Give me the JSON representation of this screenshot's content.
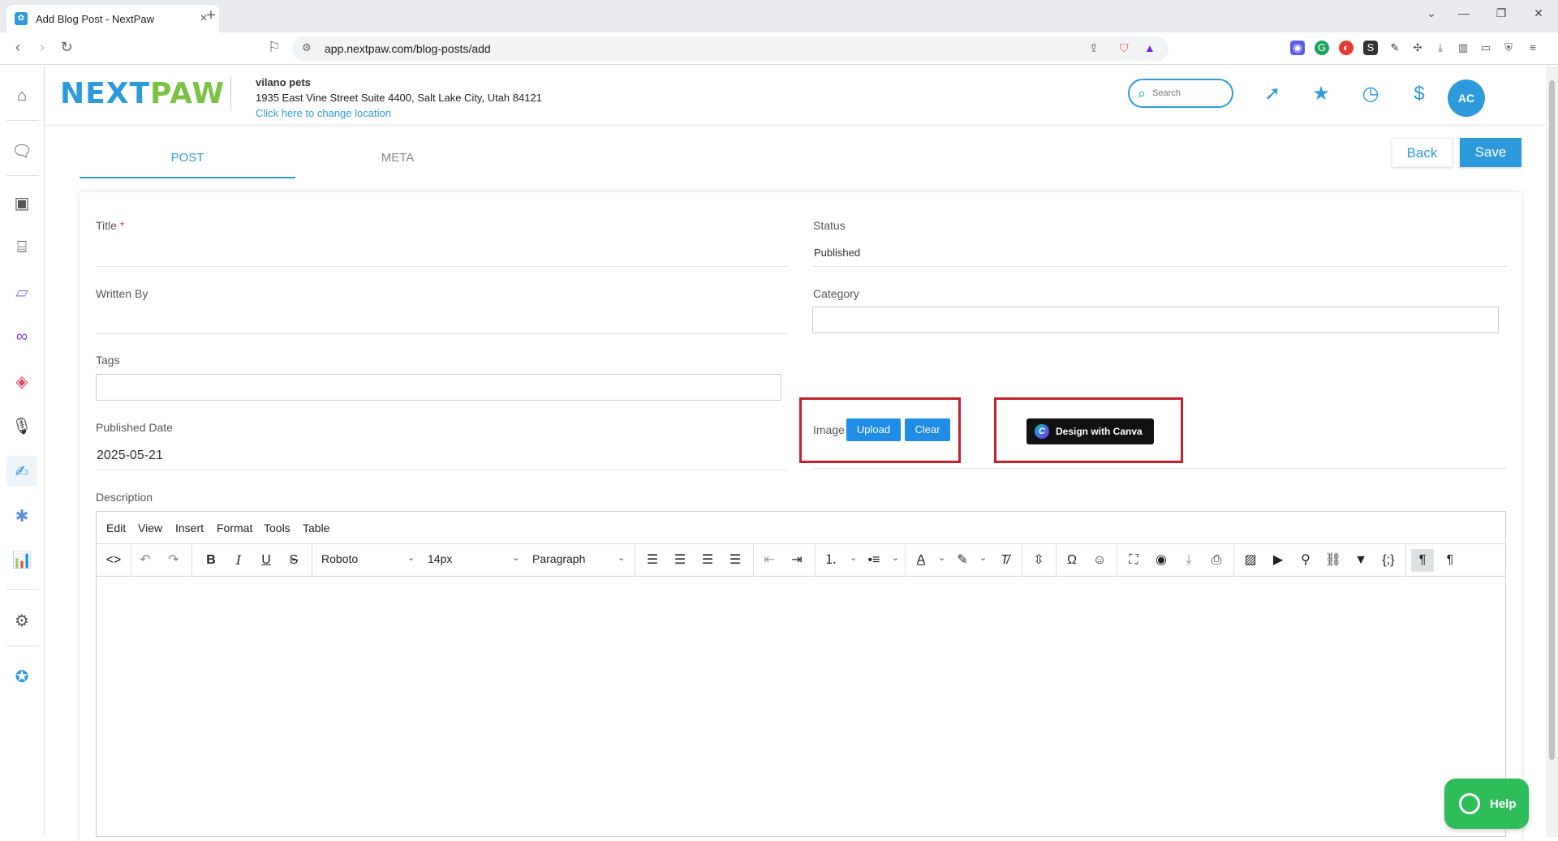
{
  "browser": {
    "tab_title": "Add Blog Post - NextPaw",
    "url": "app.nextpaw.com/blog-posts/add"
  },
  "header": {
    "logo_next": "NEXT",
    "logo_paw": "PAW",
    "location_name": "vilano pets",
    "location_address": "1935 East Vine Street Suite 4400, Salt Lake City, Utah 84121",
    "change_location": "Click here to change location",
    "search_placeholder": "Search",
    "avatar_initials": "AC"
  },
  "tabs": [
    {
      "label": "POST",
      "active": true
    },
    {
      "label": "META",
      "active": false
    }
  ],
  "actions": {
    "back": "Back",
    "save": "Save"
  },
  "form": {
    "title_label": "Title",
    "title_required": "*",
    "title_value": "",
    "status_label": "Status",
    "status_value": "Published",
    "written_by_label": "Written By",
    "written_by_value": "",
    "category_label": "Category",
    "category_value": "",
    "tags_label": "Tags",
    "tags_value": "",
    "published_date_label": "Published Date",
    "published_date_value": "2025-05-21",
    "image_label": "Image",
    "upload": "Upload",
    "clear": "Clear",
    "design_with_canva": "Design with Canva",
    "description_label": "Description"
  },
  "editor": {
    "menu": [
      "Edit",
      "View",
      "Insert",
      "Format",
      "Tools",
      "Table"
    ],
    "font_family": "Roboto",
    "font_size": "14px",
    "block_format": "Paragraph"
  },
  "help": {
    "label": "Help"
  },
  "colors": {
    "brand_blue": "#2d9bdb",
    "brand_green": "#7cc243",
    "highlight_red": "#c8202a",
    "help_green": "#2ebd59"
  }
}
